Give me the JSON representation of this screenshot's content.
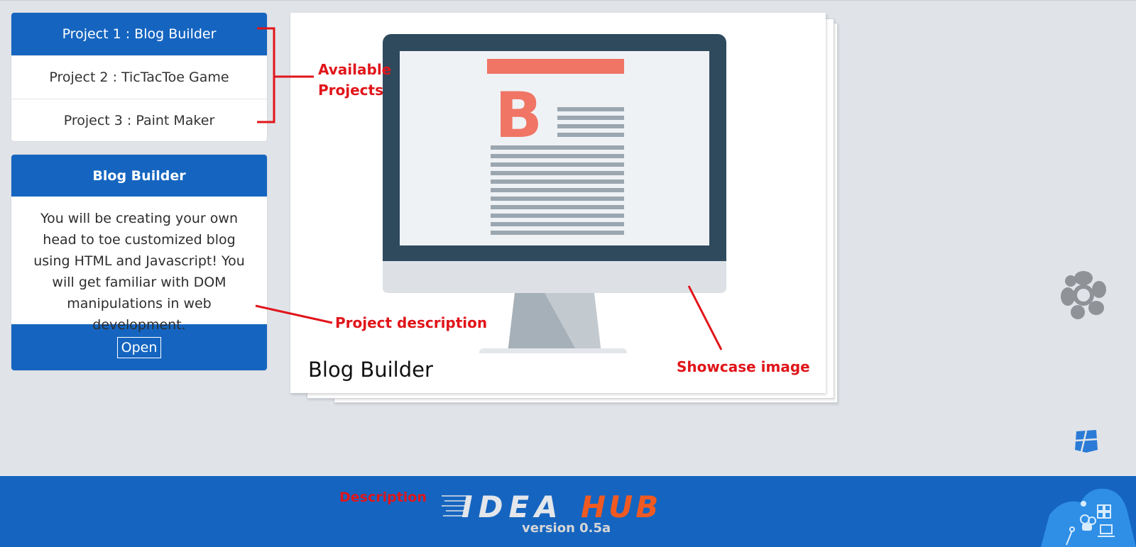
{
  "projects": [
    {
      "label": "Project 1 : Blog Builder",
      "active": true
    },
    {
      "label": "Project 2 : TicTacToe Game",
      "active": false
    },
    {
      "label": "Project 3 : Paint Maker",
      "active": false
    }
  ],
  "description_card": {
    "title": "Blog Builder",
    "body": "You will be creating your own head to toe customized blog using HTML and Javascript! You will get familiar with DOM manipulations in web development.",
    "open_label": "Open"
  },
  "showcase": {
    "title": "Blog Builder",
    "image_letter": "B"
  },
  "annotations": {
    "available_projects_line1": "Available",
    "available_projects_line2": "Projects",
    "project_description": "Project description",
    "showcase_image": "Showcase image",
    "footer_description": "Description"
  },
  "footer": {
    "logo_left": "IDEA",
    "logo_right": "HUB",
    "version": "version 0.5a"
  },
  "colors": {
    "primary": "#1565c0",
    "annotation_red": "#e0151a",
    "logo_orange": "#f05a22",
    "monitor_frame": "#2f4a5d",
    "blog_accent": "#f07565",
    "background": "#e0e4e9"
  },
  "icons": {
    "settings": "gear-icon",
    "windows": "windows-icon",
    "mascot": "robot-mascot-icon"
  }
}
